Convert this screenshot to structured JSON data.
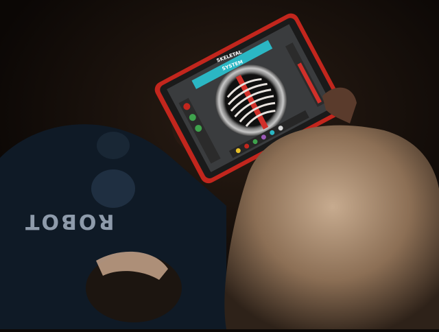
{
  "scene": {
    "description_tags": [
      "child",
      "tablet",
      "dark-room"
    ],
    "shirt_print_text": "ROBOT",
    "app_screen": {
      "title": "SKELETAL SYSTEM",
      "accent_color": "#2bb7c4",
      "case_color": "#c2261d",
      "ribcage_color": "#e8e3df",
      "spine_color": "#d1302a",
      "side_level": 0.7
    }
  }
}
